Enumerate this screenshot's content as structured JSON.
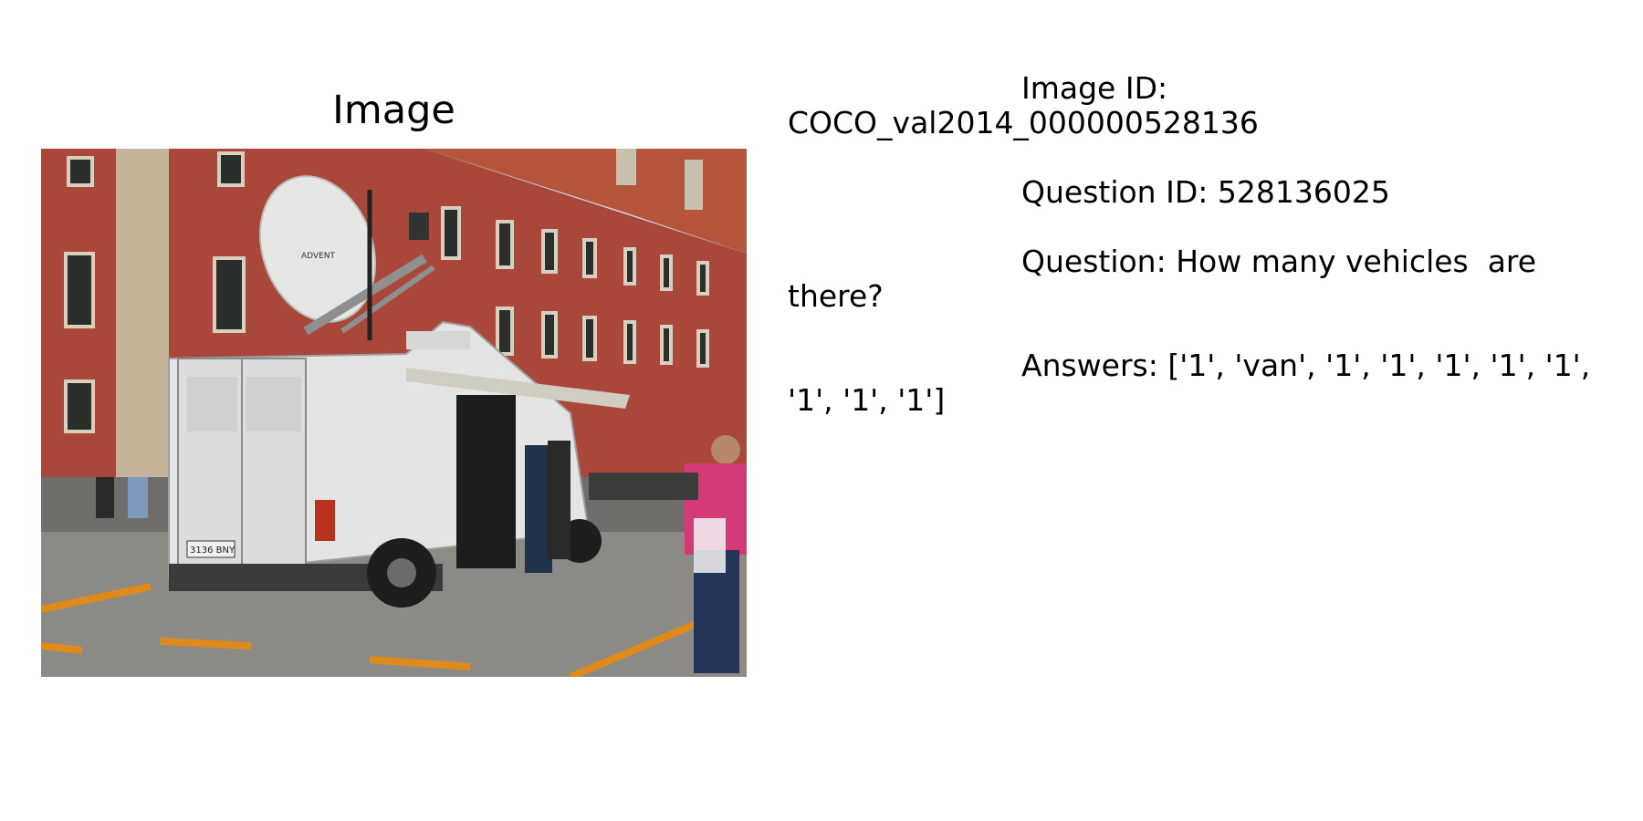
{
  "panel": {
    "title": "Image"
  },
  "photo": {
    "plate_text": "3136 BNY",
    "dish_logo_text": "ADVENT"
  },
  "info": {
    "image_id_label": "Image ID:",
    "image_id_value": "COCO_val2014_000000528136",
    "question_id_label": "Question ID:",
    "question_id_value": "528136025",
    "question_label": "Question:",
    "question_value": "How many vehicles  are there?",
    "answers_label": "Answers:",
    "answers_value": "['1', 'van', '1', '1', '1', '1', '1', '1', '1', '1']"
  }
}
